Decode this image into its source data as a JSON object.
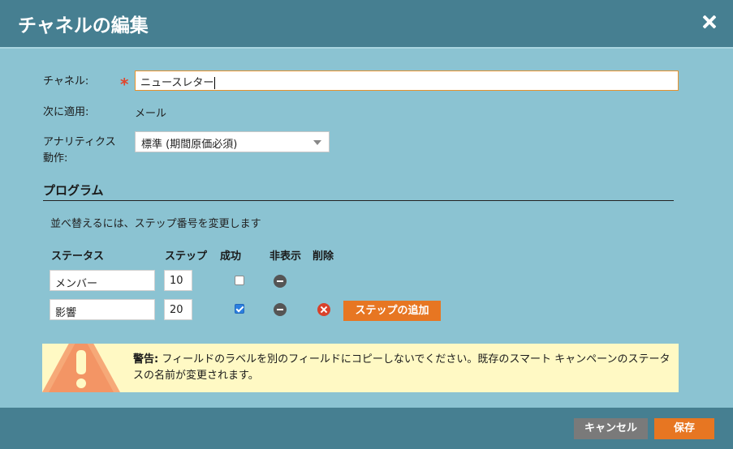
{
  "dialog": {
    "title": "チャネルの編集",
    "close_icon": "close-icon"
  },
  "form": {
    "channel_label": "チャネル:",
    "channel_value": "ニュースレター",
    "applies_label": "次に適用:",
    "applies_value": "メール",
    "analytics_label_1": "アナリティクス",
    "analytics_label_2": "動作:",
    "analytics_value": "標準 (期間原価必須)"
  },
  "program": {
    "heading": "プログラム",
    "hint": "並べ替えるには、ステップ番号を変更します",
    "columns": {
      "status": "ステータス",
      "step": "ステップ",
      "success": "成功",
      "hidden": "非表示",
      "delete": "削除"
    },
    "rows": [
      {
        "status": "メンバー",
        "step": "10",
        "success": false
      },
      {
        "status": "影響",
        "step": "20",
        "success": true
      }
    ],
    "add_step_label": "ステップの追加"
  },
  "warning": {
    "prefix": "警告:",
    "message": " フィールドのラベルを別のフィールドにコピーしないでください。既存のスマート キャンペーンのステータスの名前が変更されます。"
  },
  "footer": {
    "cancel_label": "キャンセル",
    "save_label": "保存"
  },
  "colors": {
    "accent": "#e77622",
    "header": "#467f91",
    "body": "#8bc3d2",
    "warning_bg": "#fff9c4"
  }
}
